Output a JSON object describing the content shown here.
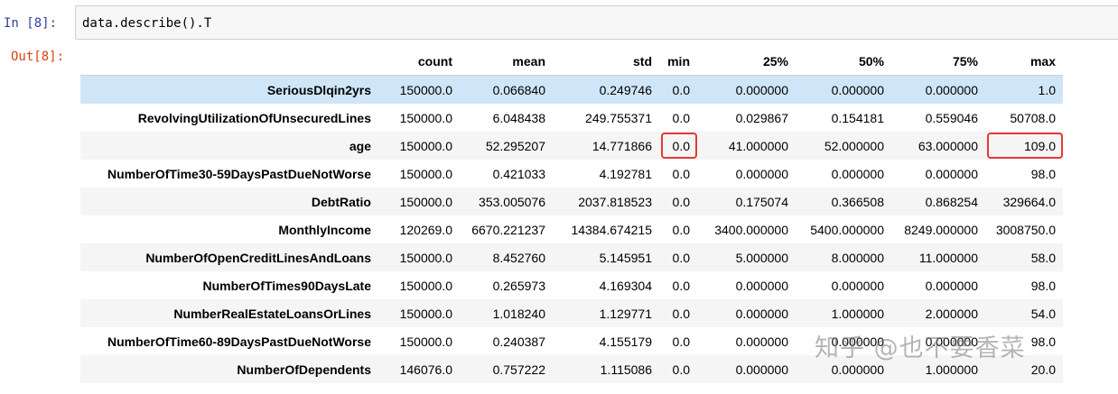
{
  "input": {
    "prompt": "In  [8]:",
    "code": "data.describe().T"
  },
  "output": {
    "prompt": "Out[8]:"
  },
  "table": {
    "columns": [
      "count",
      "mean",
      "std",
      "min",
      "25%",
      "50%",
      "75%",
      "max"
    ],
    "rows": [
      {
        "name": "SeriousDlqin2yrs",
        "cells": [
          "150000.0",
          "0.066840",
          "0.249746",
          "0.0",
          "0.000000",
          "0.000000",
          "0.000000",
          "1.0"
        ]
      },
      {
        "name": "RevolvingUtilizationOfUnsecuredLines",
        "cells": [
          "150000.0",
          "6.048438",
          "249.755371",
          "0.0",
          "0.029867",
          "0.154181",
          "0.559046",
          "50708.0"
        ]
      },
      {
        "name": "age",
        "cells": [
          "150000.0",
          "52.295207",
          "14.771866",
          "0.0",
          "41.000000",
          "52.000000",
          "63.000000",
          "109.0"
        ]
      },
      {
        "name": "NumberOfTime30-59DaysPastDueNotWorse",
        "cells": [
          "150000.0",
          "0.421033",
          "4.192781",
          "0.0",
          "0.000000",
          "0.000000",
          "0.000000",
          "98.0"
        ]
      },
      {
        "name": "DebtRatio",
        "cells": [
          "150000.0",
          "353.005076",
          "2037.818523",
          "0.0",
          "0.175074",
          "0.366508",
          "0.868254",
          "329664.0"
        ]
      },
      {
        "name": "MonthlyIncome",
        "cells": [
          "120269.0",
          "6670.221237",
          "14384.674215",
          "0.0",
          "3400.000000",
          "5400.000000",
          "8249.000000",
          "3008750.0"
        ]
      },
      {
        "name": "NumberOfOpenCreditLinesAndLoans",
        "cells": [
          "150000.0",
          "8.452760",
          "5.145951",
          "0.0",
          "5.000000",
          "8.000000",
          "11.000000",
          "58.0"
        ]
      },
      {
        "name": "NumberOfTimes90DaysLate",
        "cells": [
          "150000.0",
          "0.265973",
          "4.169304",
          "0.0",
          "0.000000",
          "0.000000",
          "0.000000",
          "98.0"
        ]
      },
      {
        "name": "NumberRealEstateLoansOrLines",
        "cells": [
          "150000.0",
          "1.018240",
          "1.129771",
          "0.0",
          "0.000000",
          "1.000000",
          "2.000000",
          "54.0"
        ]
      },
      {
        "name": "NumberOfTime60-89DaysPastDueNotWorse",
        "cells": [
          "150000.0",
          "0.240387",
          "4.155179",
          "0.0",
          "0.000000",
          "0.000000",
          "0.000000",
          "98.0"
        ]
      },
      {
        "name": "NumberOfDependents",
        "cells": [
          "146076.0",
          "0.757222",
          "1.115086",
          "0.0",
          "0.000000",
          "0.000000",
          "1.000000",
          "20.0"
        ]
      }
    ]
  },
  "watermark": "知乎 @也不要香菜",
  "colors": {
    "highlight_box": "#e53935",
    "selected_row": "#cfe6f8",
    "in_prompt": "#303f9f",
    "out_prompt": "#d84315"
  }
}
